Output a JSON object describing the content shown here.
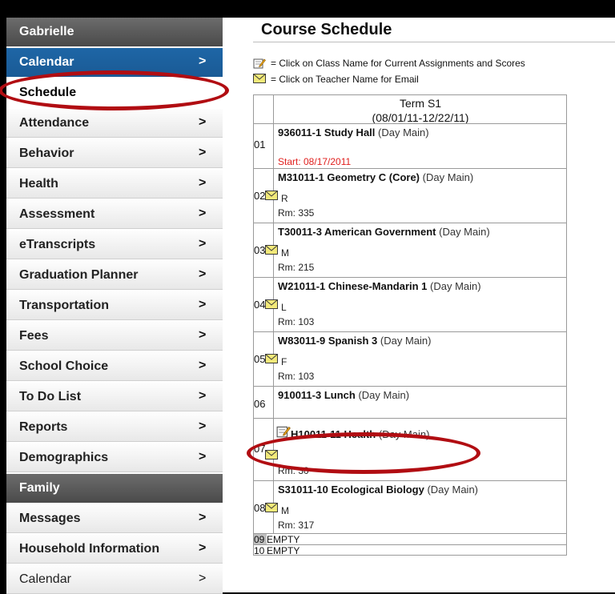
{
  "sidebar": {
    "student_header": "Gabrielle",
    "items": [
      {
        "label": "Calendar",
        "style": "active"
      },
      {
        "label": "Schedule",
        "style": "plain"
      },
      {
        "label": "Attendance"
      },
      {
        "label": "Behavior"
      },
      {
        "label": "Health"
      },
      {
        "label": "Assessment"
      },
      {
        "label": "eTranscripts"
      },
      {
        "label": "Graduation Planner"
      },
      {
        "label": "Transportation"
      },
      {
        "label": "Fees"
      },
      {
        "label": "School Choice"
      },
      {
        "label": "To Do List"
      },
      {
        "label": "Reports"
      },
      {
        "label": "Demographics"
      }
    ],
    "family_header": "Family",
    "family_items": [
      {
        "label": "Messages"
      },
      {
        "label": "Household Information"
      },
      {
        "label": "Calendar"
      }
    ],
    "chevron": ">"
  },
  "page": {
    "title": "Course Schedule",
    "legend_assignments": "= Click on Class Name for Current Assignments and Scores",
    "legend_email": "= Click on Teacher Name for Email"
  },
  "schedule": {
    "term_label": "Term S1",
    "term_dates": "(08/01/11-12/22/11)",
    "periods": [
      {
        "num": "01",
        "class": "936011-1 Study Hall",
        "meta": "(Day Main)",
        "start": "Start: 08/17/2011"
      },
      {
        "num": "02",
        "class": "M31011-1 Geometry C (Core)",
        "meta": "(Day Main)",
        "teacher": "R",
        "room": "Rm: 335"
      },
      {
        "num": "03",
        "class": "T30011-3 American Government",
        "meta": "(Day Main)",
        "teacher": "M",
        "room": "Rm: 215"
      },
      {
        "num": "04",
        "class": "W21011-1 Chinese-Mandarin 1",
        "meta": "(Day Main)",
        "teacher": "L",
        "room": "Rm: 103"
      },
      {
        "num": "05",
        "class": "W83011-9 Spanish 3",
        "meta": "(Day Main)",
        "teacher": "F",
        "room": "Rm: 103"
      },
      {
        "num": "06",
        "class": "910011-3 Lunch",
        "meta": "(Day Main)"
      },
      {
        "num": "07",
        "class": "H10011-11 Health",
        "meta": "(Day Main)",
        "room": "Rm: 30"
      },
      {
        "num": "08",
        "class": "S31011-10 Ecological Biology",
        "meta": "(Day Main)",
        "teacher": "M",
        "room": "Rm: 317"
      },
      {
        "num": "09",
        "empty": "EMPTY"
      },
      {
        "num": "10",
        "empty": "EMPTY"
      }
    ]
  },
  "colors": {
    "active_nav": "#1a5a95",
    "header_nav": "#5a5a5a",
    "start_text": "#e0201e",
    "annotation": "#b10d12"
  }
}
